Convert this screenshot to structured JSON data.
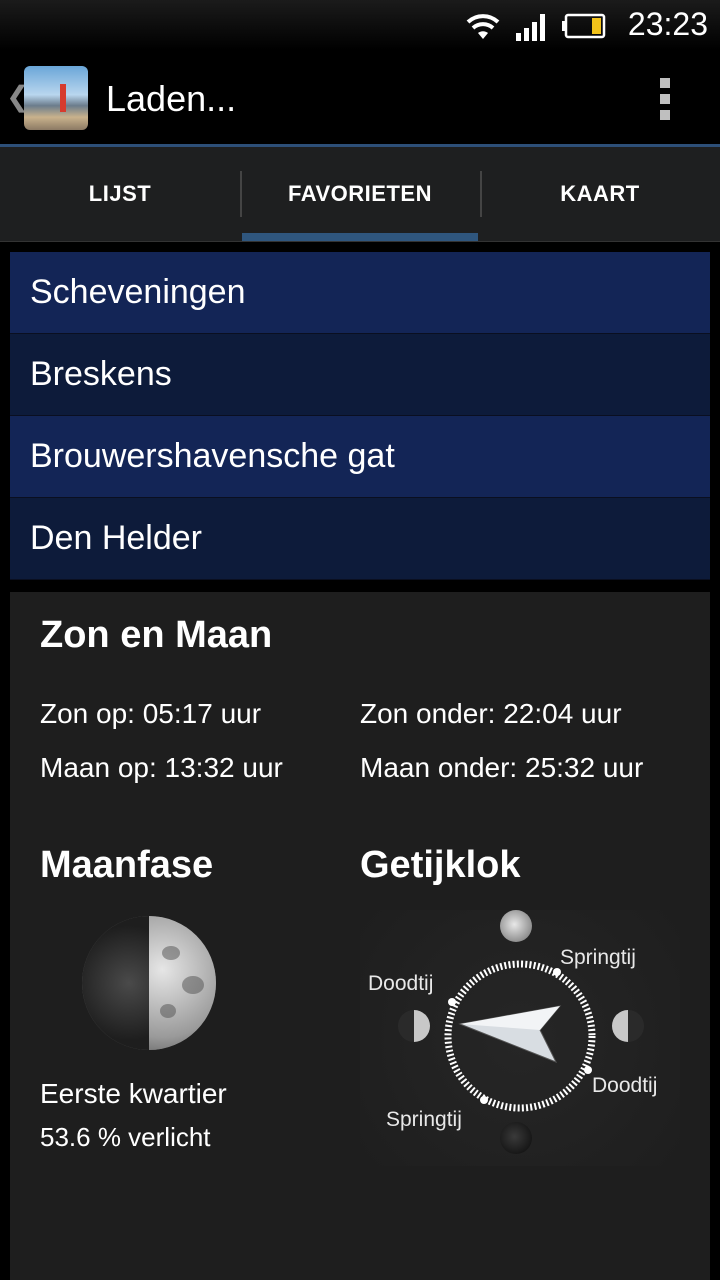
{
  "status_bar": {
    "time": "23:23",
    "icons": [
      "wifi-icon",
      "signal-icon",
      "battery-icon"
    ]
  },
  "action_bar": {
    "title": "Laden...",
    "icons": [
      "back-caret-icon",
      "app-thumbnail",
      "overflow-menu-icon"
    ]
  },
  "tabs": [
    {
      "label": "LIJST",
      "active": false
    },
    {
      "label": "FAVORIETEN",
      "active": true
    },
    {
      "label": "KAART",
      "active": false
    }
  ],
  "favorites": [
    "Scheveningen",
    "Breskens",
    "Brouwershavensche gat",
    "Den Helder"
  ],
  "sun_moon": {
    "title": "Zon en Maan",
    "sunrise": "Zon op: 05:17 uur",
    "sunset": "Zon onder: 22:04 uur",
    "moonrise": "Maan op: 13:32 uur",
    "moonset": "Maan onder: 25:32 uur"
  },
  "moon_phase": {
    "title": "Maanfase",
    "phase_name": "Eerste kwartier",
    "illumination": "53.6 % verlicht"
  },
  "tide_clock": {
    "title": "Getijklok",
    "labels": {
      "springtij_top": "Springtij",
      "doodtij_left": "Doodtij",
      "doodtij_right": "Doodtij",
      "springtij_bottom": "Springtij"
    }
  },
  "colors": {
    "list_odd": "#132556",
    "list_even": "#0d1b3a",
    "tab_indicator": "#2f567e",
    "panel_bg": "#1e1e1e"
  }
}
